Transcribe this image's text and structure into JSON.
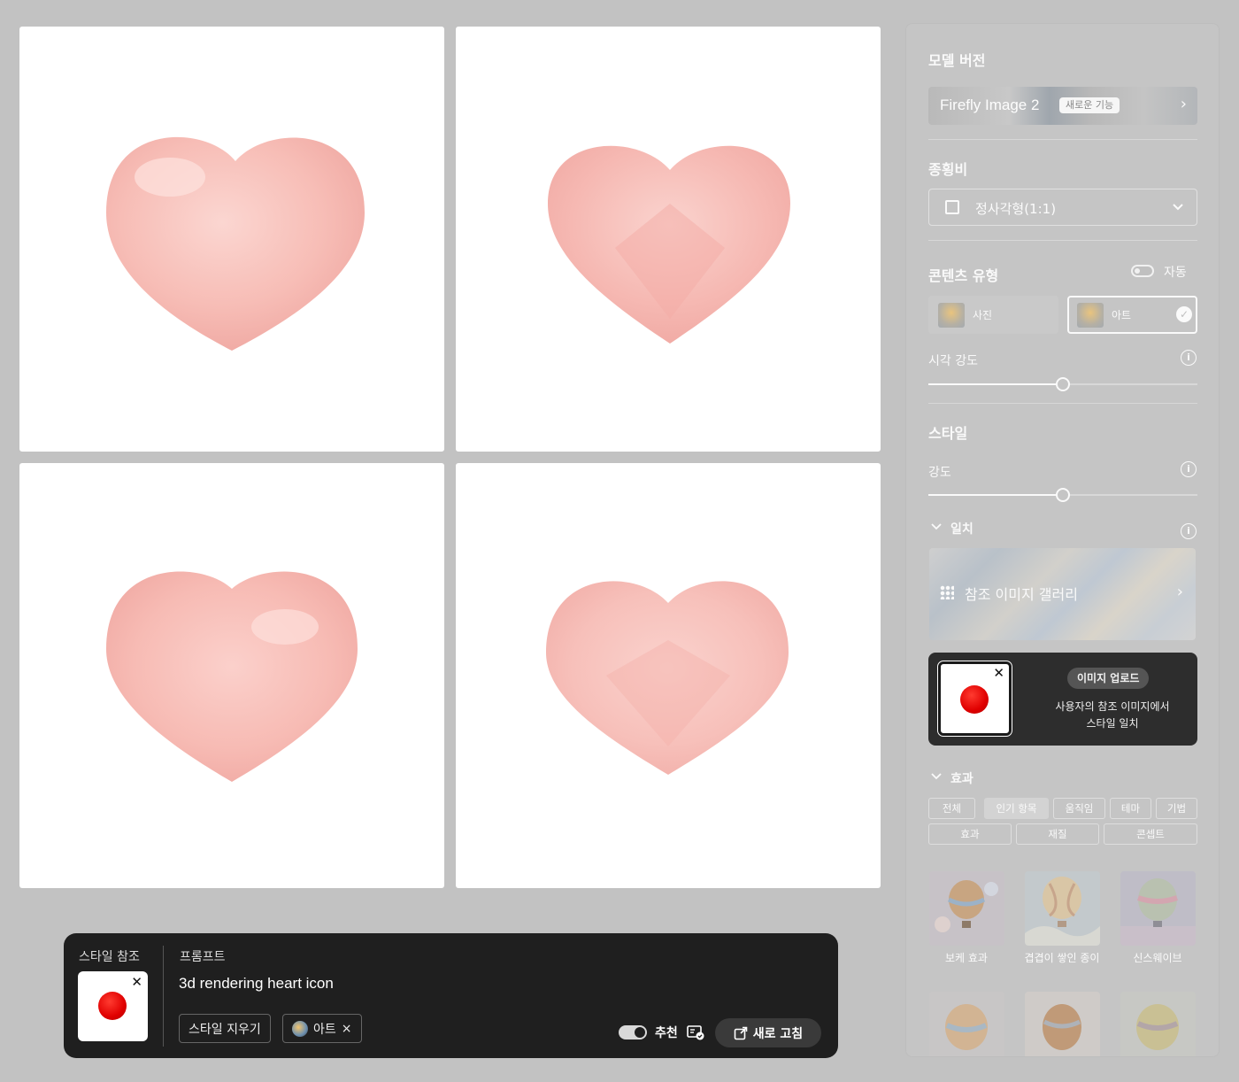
{
  "prompt_bar": {
    "style_ref_title": "스타일 참조",
    "prompt_title": "프롬프트",
    "prompt_text": "3d rendering heart icon",
    "clear_style_label": "스타일 지우기",
    "art_chip_label": "아트",
    "chip_close": "×",
    "thumb_close": "✕",
    "recommend_label": "추천",
    "refresh_label": "새로 고침"
  },
  "panel": {
    "model_version": {
      "title": "모델 버전",
      "name": "Firefly Image 2",
      "badge": "새로운 기능"
    },
    "aspect_ratio": {
      "title": "종횡비",
      "value": "정사각형(1:1)"
    },
    "content_type": {
      "title": "콘텐츠 유형",
      "auto_label": "자동",
      "options": [
        {
          "label": "사진",
          "selected": false
        },
        {
          "label": "아트",
          "selected": true
        }
      ]
    },
    "visual_intensity": {
      "label": "시각 강도",
      "value": 0.5
    },
    "style": {
      "title": "스타일",
      "strength_label": "강도",
      "strength_value": 0.5
    },
    "match": {
      "title": "일치",
      "gallery_label": "참조 이미지 갤러리",
      "upload_button": "이미지 업로드",
      "upload_desc_line1": "사용자의 참조 이미지에서",
      "upload_desc_line2": "스타일 일치",
      "thumb_close": "✕"
    },
    "effects": {
      "title": "효과",
      "tags_row1": [
        "전체",
        "인기 항목",
        "움직임",
        "테마",
        "기법"
      ],
      "tags_row2": [
        "효과",
        "재질",
        "콘셉트"
      ],
      "active_tag": "인기 항목",
      "items": [
        {
          "label": "보케 효과"
        },
        {
          "label": "겹겹이 쌓인 종이"
        },
        {
          "label": "신스웨이브"
        }
      ]
    }
  },
  "colors": {
    "heart_base": "#f8c6c1",
    "heart_shade": "#f4aaa6",
    "accent_red": "#e00000",
    "dark_bar": "#1f1f1f"
  },
  "icons": {
    "model_chevron": "chevron-right-icon",
    "aspect_chevron": "chevron-down-icon",
    "info": "info-icon",
    "collapse": "chevron-down-icon",
    "refresh": "refresh-icon"
  }
}
